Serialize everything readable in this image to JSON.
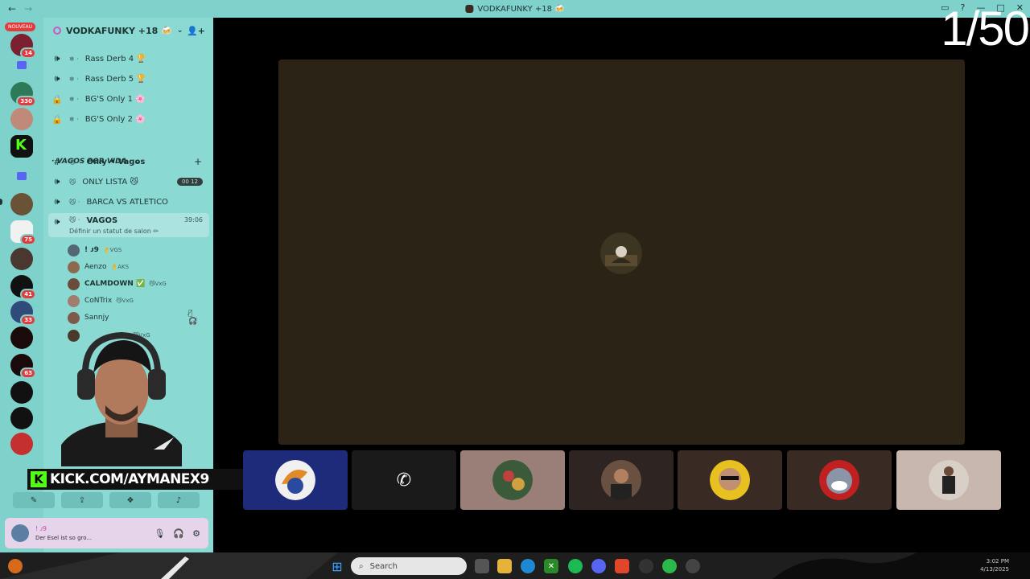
{
  "window": {
    "title": "VODKAFUNKY +18 🍻",
    "counter": "1/50",
    "nav_back": "←",
    "nav_forward": "→"
  },
  "rail": {
    "new_label": "NOUVEAU",
    "badges": [
      "14",
      "330",
      "75",
      "41",
      "33",
      "63"
    ]
  },
  "server": {
    "name": "VODKAFUNKY +18 🍻",
    "channels": [
      {
        "icon": "speaker-icon",
        "prefix": "❄ ·",
        "name": "Rass Derb 4 🏆"
      },
      {
        "icon": "speaker-icon",
        "prefix": "❄ ·",
        "name": "Rass Derb 5 🏆"
      },
      {
        "icon": "lock-icon",
        "prefix": "❄ ·",
        "name": "BG'S Only 1 🌸"
      },
      {
        "icon": "lock-icon",
        "prefix": "❄ ·",
        "name": "BG'S Only 2 🌸"
      }
    ],
    "category": "· VAGOS POR VIDA ·",
    "category_channels": [
      {
        "icon": "hash-icon",
        "prefix": "😼 ·",
        "name": "Only • Vagos",
        "bold": true
      },
      {
        "icon": "speaker-icon",
        "prefix": "😼",
        "name": "ONLY LISTA 😼",
        "pill": "00 12"
      },
      {
        "icon": "speaker-icon",
        "prefix": "😼 ·",
        "name": "BARCA VS ATLETICO"
      },
      {
        "icon": "speaker-icon",
        "prefix": "😼 ·",
        "name": "VAGOS",
        "timer": "39:06",
        "sub": "Définir un statut de salon ✏"
      }
    ],
    "voice_users": [
      {
        "name": "! ᴊ9",
        "tag": "👌VGS",
        "color": "#556677"
      },
      {
        "name": "Aenzo",
        "tag": "👌AKS",
        "color": "#8b6a4f"
      },
      {
        "name": "CALMDOWN ✅",
        "tag": "😼VxG",
        "color": "#6b4c3a"
      },
      {
        "name": "CoNTrix",
        "tag": "😼VxG",
        "color": "#a07d6c"
      },
      {
        "name": "Sannjy",
        "tag": "",
        "color": "#7d5a4a",
        "icons": "🎙̸ 🎧̸"
      },
      {
        "name": "",
        "tag": "😼VxG",
        "color": "#4a3a2a"
      }
    ]
  },
  "overlay": {
    "kick_text": "KICK.COM/AYMANEX9"
  },
  "user_panel": {
    "name": "! ᴊ9",
    "status": "Der Esel ist so gro..."
  },
  "taskbar": {
    "search_placeholder": "Search",
    "clock": "3:02 PM\n4/13/2025"
  },
  "colors": {
    "sidebar": "#8ad9d3",
    "titlebar": "#7fd1cc",
    "stage": "#2b2416"
  }
}
